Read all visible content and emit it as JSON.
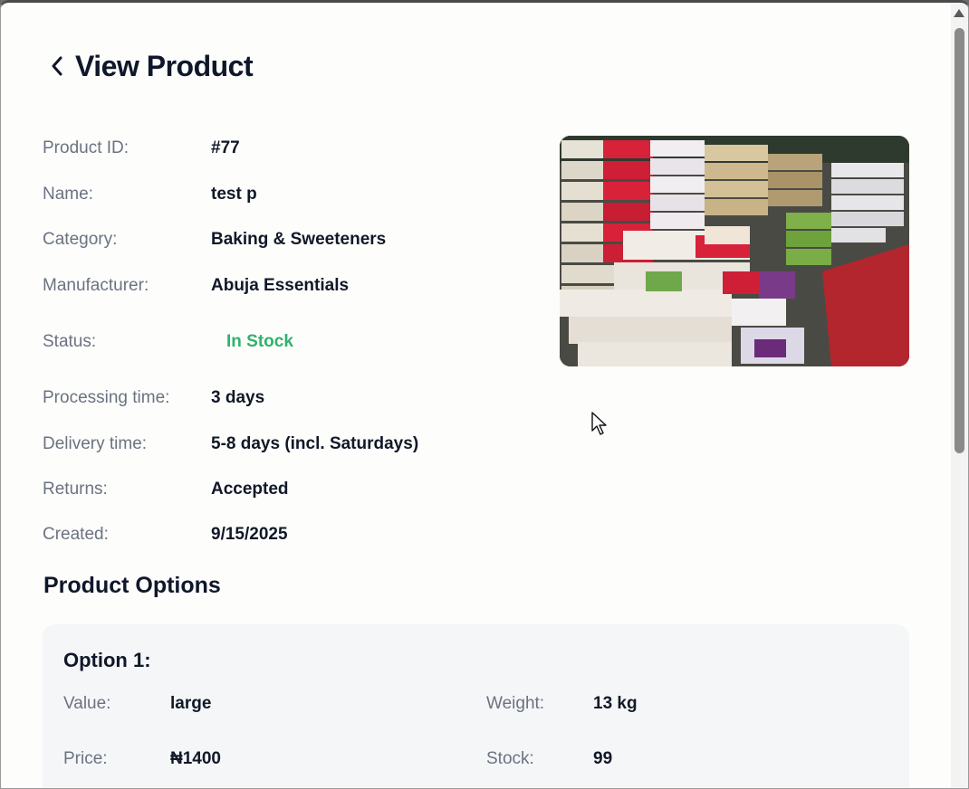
{
  "header": {
    "title": "View Product",
    "back_icon": "chevron-left-icon"
  },
  "details": [
    {
      "label": "Product ID:",
      "value": "#77"
    },
    {
      "label": "Name:",
      "value": "test p"
    },
    {
      "label": "Category:",
      "value": "Baking & Sweeteners"
    },
    {
      "label": "Manufacturer:",
      "value": "Abuja Essentials"
    },
    {
      "label": "Status:",
      "value": "In Stock"
    },
    {
      "label": "Processing time:",
      "value": "3 days"
    },
    {
      "label": "Delivery time:",
      "value": "5-8 days (incl. Saturdays)"
    },
    {
      "label": "Returns:",
      "value": "Accepted"
    },
    {
      "label": "Created:",
      "value": "9/15/2025"
    }
  ],
  "colors": {
    "status_in_stock": "#2fb36b",
    "title": "#0f172a",
    "label": "#6b7280"
  },
  "options_section": {
    "title": "Product Options",
    "options": [
      {
        "title": "Option 1:",
        "value_label": "Value:",
        "value": "large",
        "weight_label": "Weight:",
        "weight": "13 kg",
        "price_label": "Price:",
        "price": "₦1400",
        "stock_label": "Stock:",
        "stock": "99"
      }
    ]
  }
}
